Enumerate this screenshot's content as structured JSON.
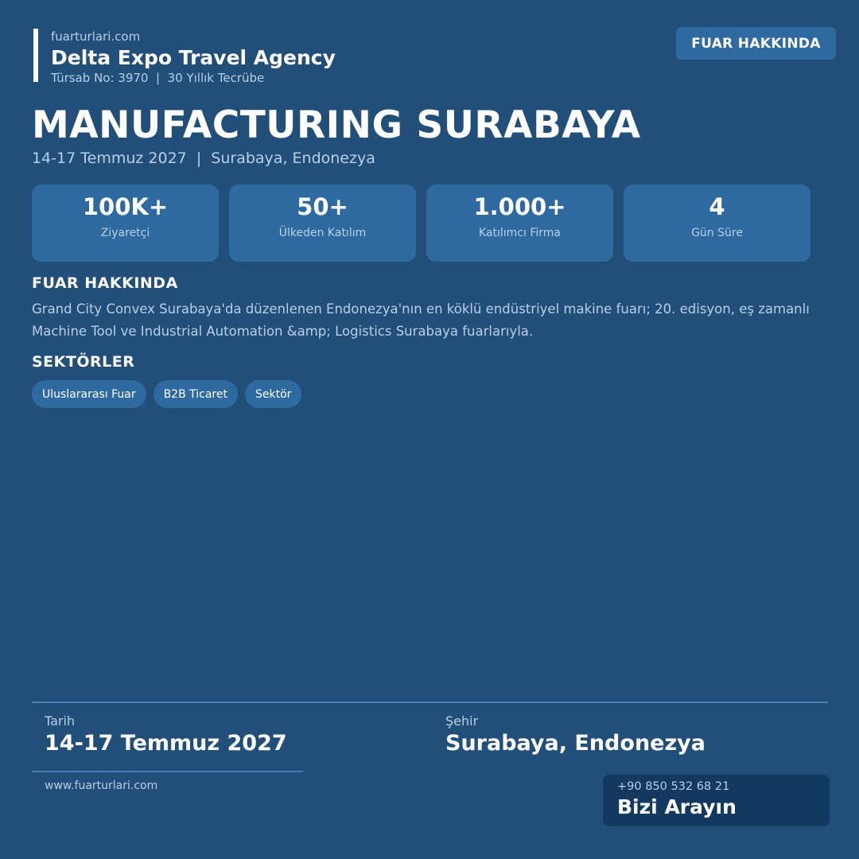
{
  "brand": {
    "site": "fuarturlari.com",
    "name": "Delta Expo Travel Agency",
    "meta": "Türsab No: 3970  |  30 Yıllık Tecrübe"
  },
  "top_button": {
    "label": "FUAR HAKKINDA"
  },
  "event": {
    "title": "MANUFACTURING SURABAYA",
    "subtitle": "14-17 Temmuz 2027  |  Surabaya, Endonezya"
  },
  "stats": [
    {
      "value": "100K+",
      "label": "Ziyaretçi"
    },
    {
      "value": "50+",
      "label": "Ülkeden Katılım"
    },
    {
      "value": "1.000+",
      "label": "Katılımcı Firma"
    },
    {
      "value": "4",
      "label": "Gün Süre"
    }
  ],
  "about": {
    "heading": "FUAR HAKKINDA",
    "text": "Grand City Convex Surabaya'da düzenlenen Endonezya'nın en köklü endüstriyel makine fuarı; 20. edisyon, eş zamanlı Machine Tool ve Industrial Automation &amp; Logistics Surabaya fuarlarıyla."
  },
  "sectors": {
    "heading": "SEKTÖRLER",
    "tags": [
      "Uluslararası Fuar",
      "B2B Ticaret",
      "Sektör"
    ]
  },
  "info": {
    "date_label": "Tarih",
    "date_value": "14-17 Temmuz 2027",
    "city_label": "Şehir",
    "city_value": "Surabaya, Endonezya"
  },
  "footer": {
    "url": "www.fuarturlari.com",
    "phone": "+90 850 532 68 21",
    "call_label": "Bizi Arayın"
  },
  "colors": {
    "background": "#214f79",
    "card": "#2e6aa0",
    "call_box": "#133961",
    "muted_text": "#b9cfe6"
  }
}
